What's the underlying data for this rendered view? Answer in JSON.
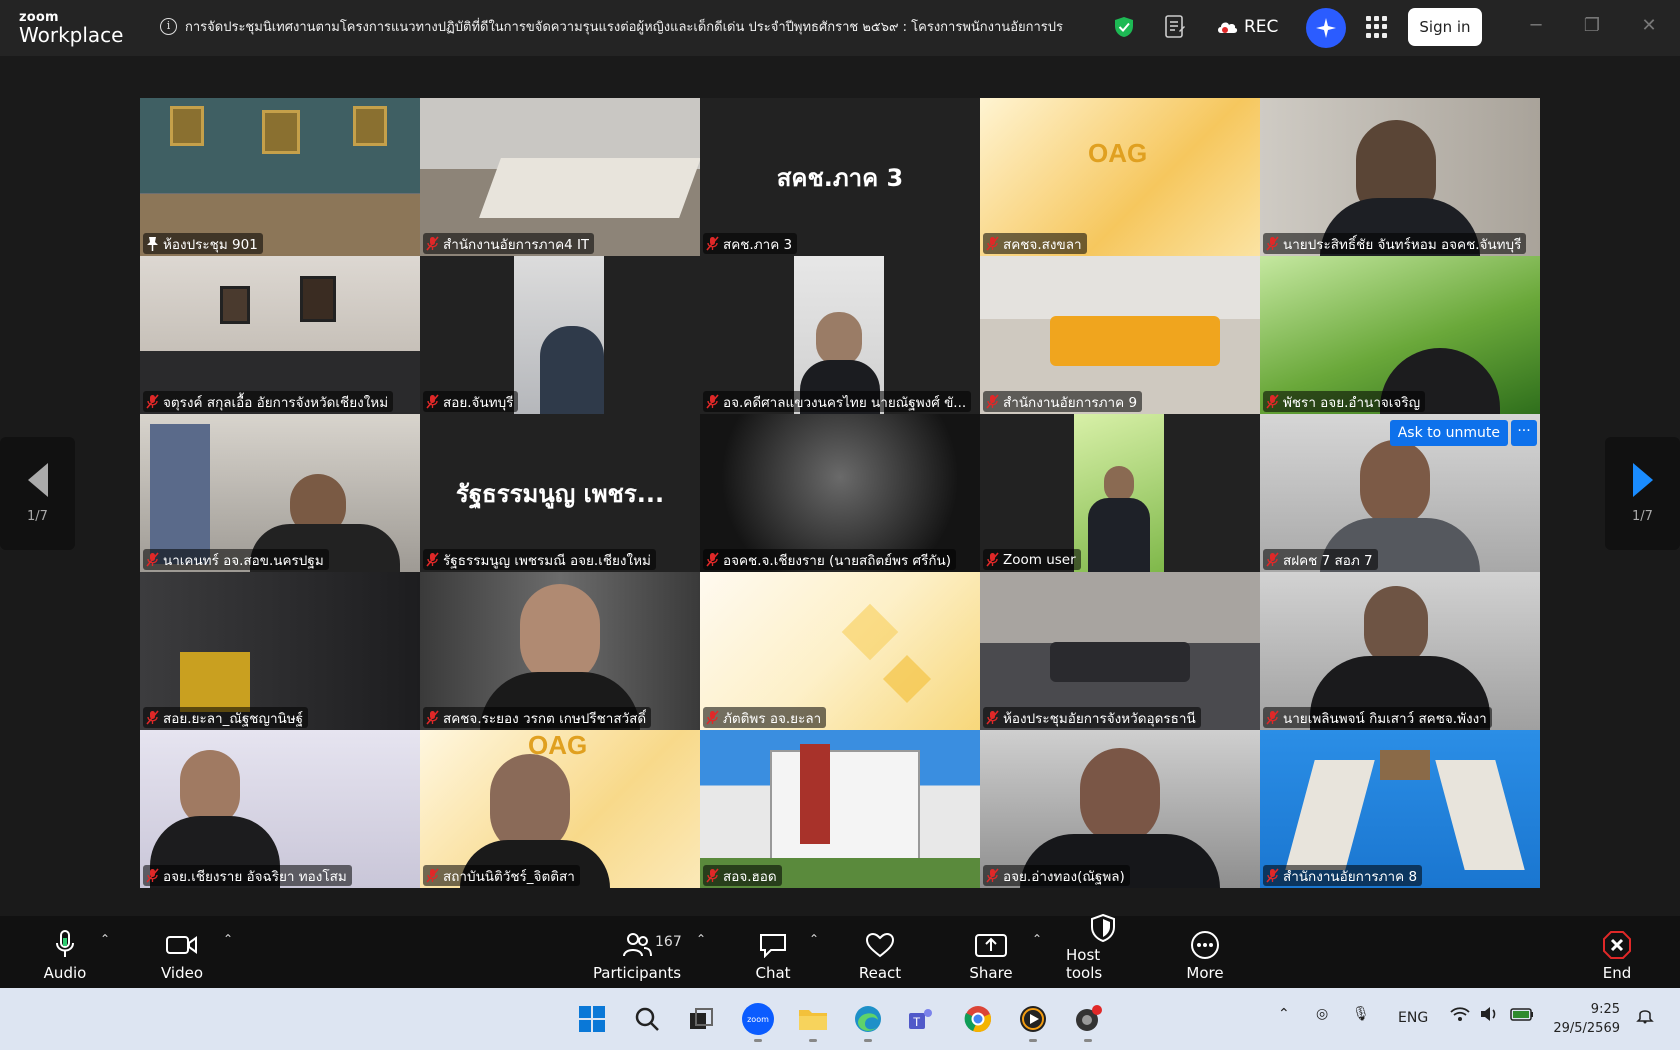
{
  "app": {
    "logo_line1": "zoom",
    "logo_line2": "Workplace"
  },
  "banner": {
    "text": "การจัดประชุมนิเทศงานตามโครงการแนวทางปฏิบัติที่ดีในการขจัดความรุนแรงต่อผู้หญิงและเด็กดีเด่น ประจำปีพุทธศักราช ๒๕๖๙ : โครงการพนักงานอัยการปร"
  },
  "topbar": {
    "rec_label": "REC",
    "signin_label": "Sign in"
  },
  "pager": {
    "left_label": "1/7",
    "right_label": "1/7"
  },
  "tile_overlay": {
    "ask_unmute": "Ask to unmute",
    "more": "···"
  },
  "tiles": [
    {
      "name": "ห้องประชุม 901",
      "pinned": true
    },
    {
      "name": "สำนักงานอัยการภาค4 IT"
    },
    {
      "name": "สคช.ภาค 3",
      "big": "สคช.ภาค 3"
    },
    {
      "name": "สคชจ.สงขลา"
    },
    {
      "name": "นายประสิทธิ์ชัย  จันทร์หอม อจคช.จันทบุรี"
    },
    {
      "name": "จตุรงค์ สกุลเอื้อ อัยการจังหวัดเชียงใหม่"
    },
    {
      "name": "สอย.จันทบุรี"
    },
    {
      "name": "อจ.คดีศาลแขวงนครไทย นายณัฐพงศ์ ขั..."
    },
    {
      "name": "สำนักงานอัยการภาค 9"
    },
    {
      "name": "พัชรา อจย.อำนาจเจริญ"
    },
    {
      "name": "นาเคนทร์ อจ.สอข.นครปฐม"
    },
    {
      "name": "รัฐธรรมนูญ เพชรมณี อจย.เชียงใหม่",
      "big": "รัฐธรรมนูญ เพชร..."
    },
    {
      "name": "อจคช.จ.เชียงราย (นายสถิตย์พร ศรีกัน)"
    },
    {
      "name": "Zoom user"
    },
    {
      "name": "สฝคช 7 สอภ 7"
    },
    {
      "name": "สอย.ยะลา_ณัฐชญานิษฐ์"
    },
    {
      "name": "สคชจ.ระยอง วรกต เกษปรีชาสวัสดิ์"
    },
    {
      "name": "ภัตติพร อจ.ยะลา"
    },
    {
      "name": "ห้องประชุมอัยการจังหวัดอุดรธานี"
    },
    {
      "name": "นายเพลินพจน์ กิมเสาว์ สคชจ.พังงา"
    },
    {
      "name": "อจย.เชียงราย อัจฉริยา ทองโสม"
    },
    {
      "name": "สถาบันนิติวัชร์_จิตติสา"
    },
    {
      "name": "สอจ.ฮอด"
    },
    {
      "name": "อจย.อ่างทอง(ณัฐพล)"
    },
    {
      "name": "สำนักงานอัยการภาค 8"
    }
  ],
  "toolbar": {
    "audio": "Audio",
    "video": "Video",
    "participants": "Participants",
    "participants_count": "167",
    "chat": "Chat",
    "react": "React",
    "share": "Share",
    "host_tools": "Host tools",
    "more": "More",
    "end": "End"
  },
  "taskbar": {
    "language": "ENG",
    "time": "9:25",
    "date": "29/5/2569",
    "zoom_icon_text": "zoom"
  },
  "colors": {
    "active_speaker": "#23d96a",
    "accent_blue": "#0e71eb",
    "muted_red": "#e02828"
  }
}
